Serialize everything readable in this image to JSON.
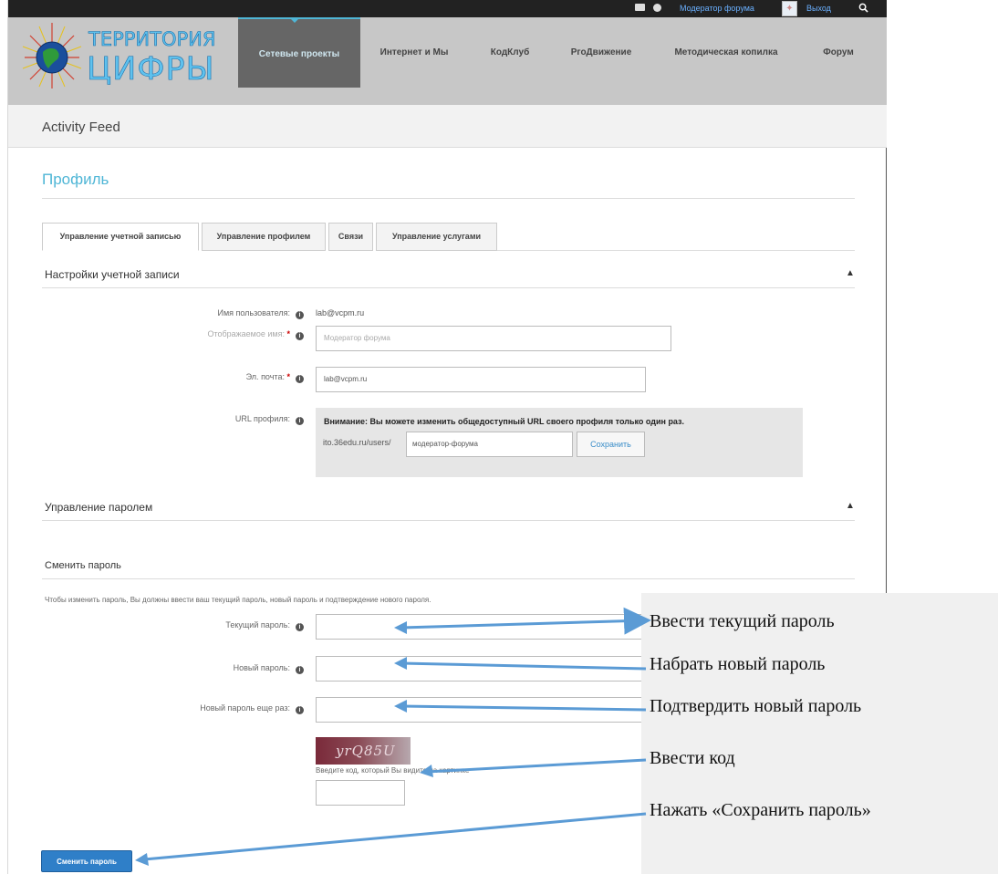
{
  "topbar": {
    "user_link": "Модератор форума",
    "logout": "Выход",
    "icons": [
      "mail-icon",
      "chat-icon",
      "avatar",
      "search-icon"
    ]
  },
  "logo": {
    "line1": "ТЕРРИТОРИЯ",
    "line2": "ЦИФРЫ"
  },
  "nav": {
    "items": [
      {
        "label": "Сетевые проекты",
        "active": true
      },
      {
        "label": "Интернет и Мы"
      },
      {
        "label": "КодКлуб"
      },
      {
        "label": "РгоДвижение"
      },
      {
        "label": "Методическая копилка"
      },
      {
        "label": "Форум"
      }
    ]
  },
  "feed": {
    "title": "Activity Feed"
  },
  "profile": {
    "title": "Профиль",
    "tabs": [
      "Управление учетной записью",
      "Управление профилем",
      "Связи",
      "Управление услугами"
    ],
    "account": {
      "heading": "Настройки учетной записи",
      "username_label": "Имя пользователя:",
      "username_value": "lab@vcpm.ru",
      "display_label": "Отображаемое имя:",
      "display_placeholder": "Модератор форума",
      "email_label": "Эл. почта:",
      "email_value": "lab@vcpm.ru",
      "url_label": "URL профиля:",
      "url_warning": "Внимание: Вы можете изменить общедоступный URL своего профиля только один раз.",
      "url_prefix": "ito.36edu.ru/users/",
      "url_value": "модератор-форума",
      "url_save": "Сохранить"
    },
    "password": {
      "heading": "Управление паролем",
      "subheading": "Сменить пароль",
      "description": "Чтобы изменить пароль, Вы должны ввести ваш текущий пароль, новый пароль и подтверждение нового пароля.",
      "current_label": "Текущий пароль:",
      "new_label": "Новый пароль:",
      "repeat_label": "Новый пароль еще раз:",
      "captcha_text": "yrQ85U",
      "captcha_hint": "Введите код, который Вы видите на картинке",
      "submit": "Сменить пароль"
    }
  },
  "annotations": [
    "Ввести текущий пароль",
    "Набрать новый пароль",
    "Подтвердить новый пароль",
    "Ввести код",
    "Нажать «Сохранить пароль»"
  ],
  "colors": {
    "accent": "#4fb6d6",
    "nav_bg": "#c7c7c7",
    "nav_active": "#666666",
    "button": "#2f7fc8",
    "arrow": "#5b9bd5"
  }
}
